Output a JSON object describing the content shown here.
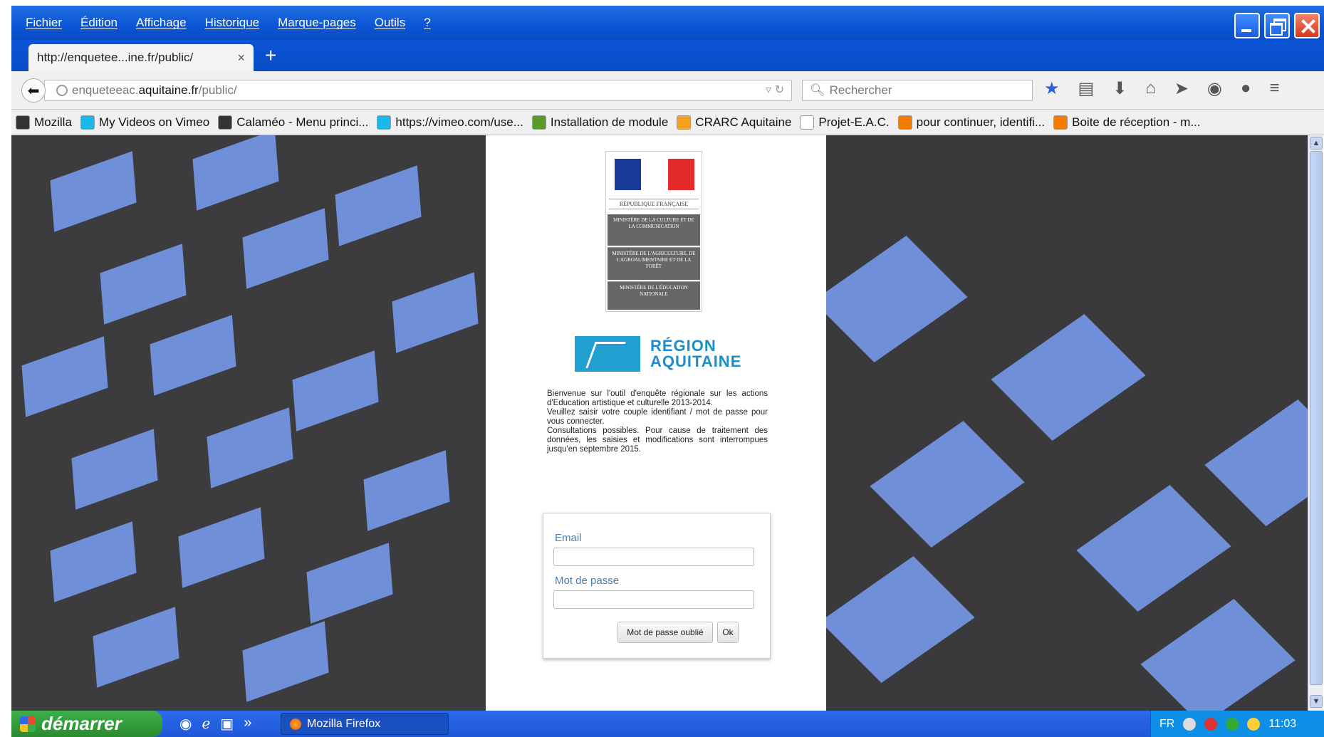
{
  "window": {
    "menu": [
      "Fichier",
      "Édition",
      "Affichage",
      "Historique",
      "Marque-pages",
      "Outils",
      "?"
    ]
  },
  "tab": {
    "title": "http://enquetee...ine.fr/public/",
    "close": "×",
    "new": "+"
  },
  "url": {
    "prefix": "enqueteeac.",
    "host": "aquitaine.fr",
    "path": "/public/"
  },
  "search": {
    "placeholder": "Rechercher"
  },
  "bookmarks": [
    {
      "label": "Mozilla",
      "icon_color": "#333"
    },
    {
      "label": "My Videos on Vimeo",
      "icon_color": "#1ab7ea"
    },
    {
      "label": "Calaméo - Menu princi...",
      "icon_color": "#333"
    },
    {
      "label": "https://vimeo.com/use...",
      "icon_color": "#1ab7ea"
    },
    {
      "label": "Installation de module",
      "icon_color": "#5a9a2a"
    },
    {
      "label": "CRARC Aquitaine",
      "icon_color": "#f5a020"
    },
    {
      "label": "Projet-E.A.C.",
      "icon_color": "#fff"
    },
    {
      "label": "pour continuer, identifi...",
      "icon_color": "#f57a00"
    },
    {
      "label": "Boite de réception - m...",
      "icon_color": "#f57a00"
    }
  ],
  "gov": {
    "republique": "RÉPUBLIQUE FRANÇAISE",
    "ministries": [
      "MINISTÈRE DE LA CULTURE ET DE LA COMMUNICATION",
      "MINISTÈRE DE L'AGRICULTURE, DE L'AGROALIMENTAIRE ET DE LA FORÊT",
      "MINISTÈRE DE L'ÉDUCATION NATIONALE"
    ]
  },
  "region": {
    "line1": "RÉGION",
    "line2": "AQUITAINE"
  },
  "intro": {
    "p1": "Bienvenue sur l'outil d'enquête régionale sur les actions d'Education artistique et culturelle 2013-2014.",
    "p2": "Veuillez saisir votre couple identifiant / mot de passe pour vous connecter.",
    "p3": "Consultations possibles. Pour cause de traitement des données, les saisies et modifications sont interrompues jusqu'en septembre 2015."
  },
  "login": {
    "email_label": "Email",
    "email_value": "",
    "password_label": "Mot de passe",
    "password_value": "",
    "forgot_button": "Mot de passe oublié",
    "ok_button": "Ok"
  },
  "taskbar": {
    "start": "démarrer",
    "app": "Mozilla Firefox",
    "lang": "FR",
    "time": "11:03"
  },
  "colors": {
    "titlebar": "#0b55d6",
    "start": "#2b8b30",
    "region": "#1d8ec8",
    "tile": "#6f8fd8"
  }
}
